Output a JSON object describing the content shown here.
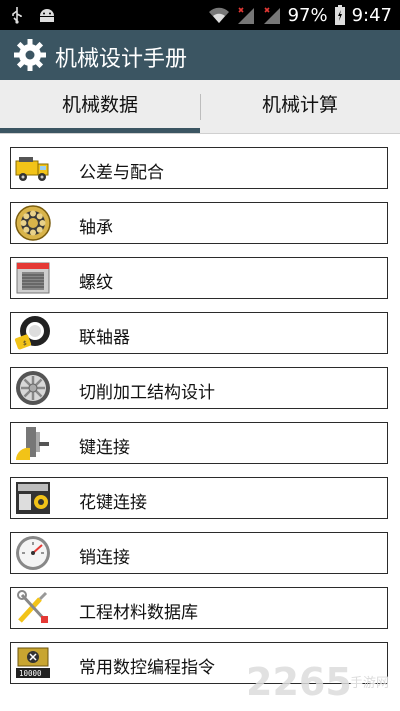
{
  "status_bar": {
    "battery": "97%",
    "time": "9:47"
  },
  "app": {
    "title": "机械设计手册"
  },
  "tabs": [
    {
      "label": "机械数据",
      "selected": true
    },
    {
      "label": "机械计算",
      "selected": false
    }
  ],
  "items": [
    {
      "label": "公差与配合",
      "icon": "truck-icon"
    },
    {
      "label": "轴承",
      "icon": "bearing-icon"
    },
    {
      "label": "螺纹",
      "icon": "thread-machine-icon"
    },
    {
      "label": "联轴器",
      "icon": "coupling-icon"
    },
    {
      "label": "切削加工结构设计",
      "icon": "wheel-icon"
    },
    {
      "label": "键连接",
      "icon": "key-connection-icon"
    },
    {
      "label": "花键连接",
      "icon": "spline-icon"
    },
    {
      "label": "销连接",
      "icon": "gauge-icon"
    },
    {
      "label": "工程材料数据库",
      "icon": "tools-icon"
    },
    {
      "label": "常用数控编程指令",
      "icon": "cnc-counter-icon"
    }
  ],
  "watermark": {
    "text": "2265",
    "subtext": "手游网"
  },
  "colors": {
    "app_bar": "#3b5562",
    "tab_bar": "#ededed",
    "status_bar": "#000000"
  }
}
